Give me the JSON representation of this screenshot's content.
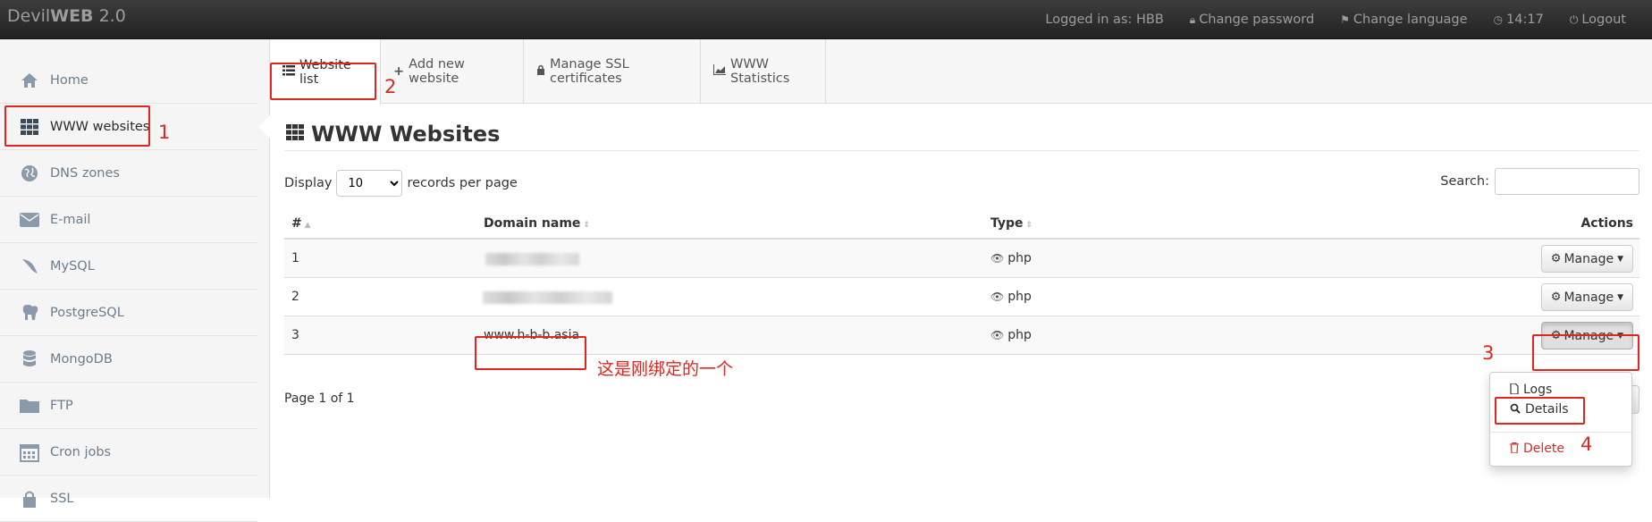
{
  "topbar": {
    "brand_prefix": "Devil",
    "brand_bold": "WEB",
    "brand_suffix": " 2.0",
    "logged_in": "Logged in as: HBB",
    "change_password": "Change password",
    "change_language": "Change language",
    "clock": "14:17",
    "logout": "Logout"
  },
  "sidebar": {
    "items": [
      {
        "label": "Home",
        "icon": "home-icon"
      },
      {
        "label": "WWW websites",
        "icon": "grid-icon"
      },
      {
        "label": "DNS zones",
        "icon": "globe-icon"
      },
      {
        "label": "E-mail",
        "icon": "envelope-icon"
      },
      {
        "label": "MySQL",
        "icon": "dolphin-icon"
      },
      {
        "label": "PostgreSQL",
        "icon": "elephant-icon"
      },
      {
        "label": "MongoDB",
        "icon": "database-icon"
      },
      {
        "label": "FTP",
        "icon": "folder-icon"
      },
      {
        "label": "Cron jobs",
        "icon": "calendar-icon"
      },
      {
        "label": "SSL",
        "icon": "lock-icon"
      }
    ]
  },
  "tabs": [
    {
      "label": "Website list",
      "icon": "list-icon"
    },
    {
      "label": "Add new website",
      "icon": "plus-icon"
    },
    {
      "label": "Manage SSL certificates",
      "icon": "lock-icon"
    },
    {
      "label": "WWW Statistics",
      "icon": "area-chart-icon"
    }
  ],
  "main": {
    "title": "WWW Websites",
    "display_label": "Display",
    "records_label": "records per page",
    "page_size": "10",
    "search_label": "Search:",
    "search_value": "",
    "columns": [
      "#",
      "Domain name",
      "Type",
      "Actions"
    ],
    "rows": [
      {
        "num": "1",
        "domain": "",
        "type": "php",
        "action": "Manage"
      },
      {
        "num": "2",
        "domain": "",
        "type": "php",
        "action": "Manage"
      },
      {
        "num": "3",
        "domain": "www.h-b-b.asia",
        "type": "php",
        "action": "Manage"
      }
    ],
    "paging": "Page 1 of 1"
  },
  "dropdown": {
    "logs": "Logs",
    "details": "Details",
    "delete": "Delete"
  },
  "annotations": {
    "n1": "1",
    "n2": "2",
    "n3": "3",
    "n4": "4",
    "note": "这是刚绑定的一个"
  },
  "colors": {
    "annotation_red": "#e0261f",
    "topbar": "#2d2d2d",
    "danger": "#c9302c"
  }
}
